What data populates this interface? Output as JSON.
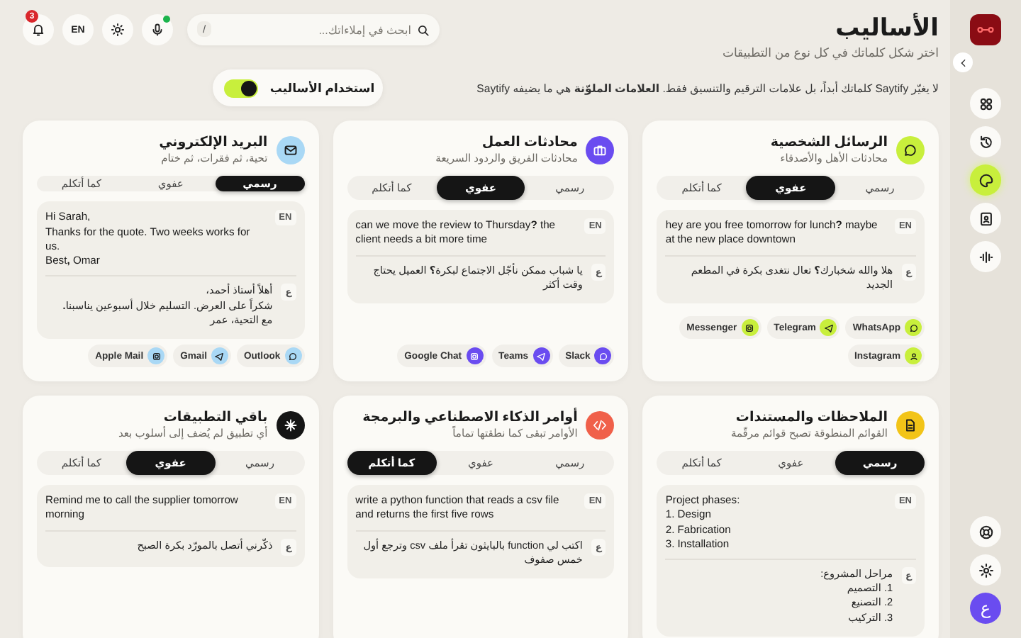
{
  "sidebar": {
    "nav": [
      {
        "selected": false
      },
      {
        "selected": false
      },
      {
        "selected": true
      },
      {
        "selected": false
      },
      {
        "selected": false
      }
    ],
    "avatar": "ع"
  },
  "header": {
    "title": "الأساليب",
    "subtitle": "اختر شكل كلماتك في كل نوع من التطبيقات"
  },
  "toolbar": {
    "search": {
      "placeholder": "ابحث في إملاءاتك...",
      "shortcut": "/"
    },
    "mic_active": true,
    "language": "EN",
    "notifications": "3"
  },
  "info": "لا يغيّر Saytify كلماتك أبداً، بل علامات الترقيم والتنسيق فقط. **العلامات الملوّنة** هي ما يضيفه Saytify",
  "styles_toggle": {
    "label": "استخدام الأساليب",
    "on": true
  },
  "cards": [
    {
      "title": "الرسائل الشخصية",
      "subtitle": "محادثات الأهل والأصدقاء",
      "color": "#c8ef3c",
      "tabs": [
        {
          "label": "رسمي",
          "selected": false
        },
        {
          "label": "عفوي",
          "selected": true
        },
        {
          "label": "كما أتكلم",
          "selected": false
        }
      ],
      "sample_en": "hey are you free tomorrow for lunch**?** maybe at the new place downtown",
      "badge_en": "EN",
      "badge_ar": "ع",
      "sample_ar": "هلا والله شخبارك**؟** تعال نتغدى بكرة في المطعم الجديد",
      "apps": [
        "WhatsApp",
        "Telegram",
        "Messenger",
        "Instagram"
      ]
    },
    {
      "title": "محادثات العمل",
      "subtitle": "محادثات الفريق والردود السريعة",
      "color": "#6a4cf0",
      "tabs": [
        {
          "label": "رسمي",
          "selected": false
        },
        {
          "label": "عفوي",
          "selected": true
        },
        {
          "label": "كما أتكلم",
          "selected": false
        }
      ],
      "sample_en": "can we move the review to Thursday**?** the client needs a bit more time",
      "badge_en": "EN",
      "badge_ar": "ع",
      "sample_ar": "يا شباب ممكن نأجّل الاجتماع لبكرة**؟** العميل يحتاج وقت أكثر",
      "apps": [
        "Slack",
        "Teams",
        "Google Chat"
      ]
    },
    {
      "title": "البريد الإلكتروني",
      "subtitle": "تحية، ثم فقرات، ثم ختام",
      "color": "#a9d8f5",
      "tabs": [
        {
          "label": "رسمي",
          "selected": true
        },
        {
          "label": "عفوي",
          "selected": false
        },
        {
          "label": "كما أتكلم",
          "selected": false
        }
      ],
      "sample_en": "Hi Sarah,\nThanks for the quote. Two weeks works for us.\nBest**,** Omar",
      "badge_en": "EN",
      "badge_ar": "ع",
      "sample_ar": "أهلاً أستاذ أحمد،\nشكراً على العرض. التسليم خلال أسبوعين يناسبنا**.**\nمع التحية، عمر",
      "apps": [
        "Outlook",
        "Gmail",
        "Apple Mail"
      ]
    },
    {
      "title": "الملاحظات والمستندات",
      "subtitle": "القوائم المنطوقة تصبح قوائم مرقّمة",
      "color": "#f2c418",
      "tabs": [
        {
          "label": "رسمي",
          "selected": true
        },
        {
          "label": "عفوي",
          "selected": false
        },
        {
          "label": "كما أتكلم",
          "selected": false
        }
      ],
      "sample_en": "Project phases:\n1. Design\n2. Fabrication\n3. Installation",
      "badge_en": "EN",
      "badge_ar": "ع",
      "sample_ar": "مراحل المشروع:\n1. التصميم\n2. التصنيع\n3. التركيب"
    },
    {
      "title": "أوامر الذكاء الاصطناعي والبرمجة",
      "subtitle": "الأوامر تبقى كما نطقتها تماماً",
      "color": "#f0604a",
      "tabs": [
        {
          "label": "رسمي",
          "selected": false
        },
        {
          "label": "عفوي",
          "selected": false
        },
        {
          "label": "كما أتكلم",
          "selected": true
        }
      ],
      "sample_en": "write a python function that reads a csv file and returns the first five rows",
      "badge_en": "EN",
      "badge_ar": "ع",
      "sample_ar": "اكتب لي function بالبايثون تقرأ ملف csv وترجع أول خمس صفوف"
    },
    {
      "title": "باقي التطبيقات",
      "subtitle": "أي تطبيق لم يُضف إلى أسلوب بعد",
      "color": "#151515",
      "tabs": [
        {
          "label": "رسمي",
          "selected": false
        },
        {
          "label": "عفوي",
          "selected": true
        },
        {
          "label": "كما أتكلم",
          "selected": false
        }
      ],
      "sample_en": "Remind me to call the supplier tomorrow morning",
      "badge_en": "EN",
      "badge_ar": "ع",
      "sample_ar": "ذكّرني أتصل بالمورّد بكرة الصبح"
    }
  ]
}
